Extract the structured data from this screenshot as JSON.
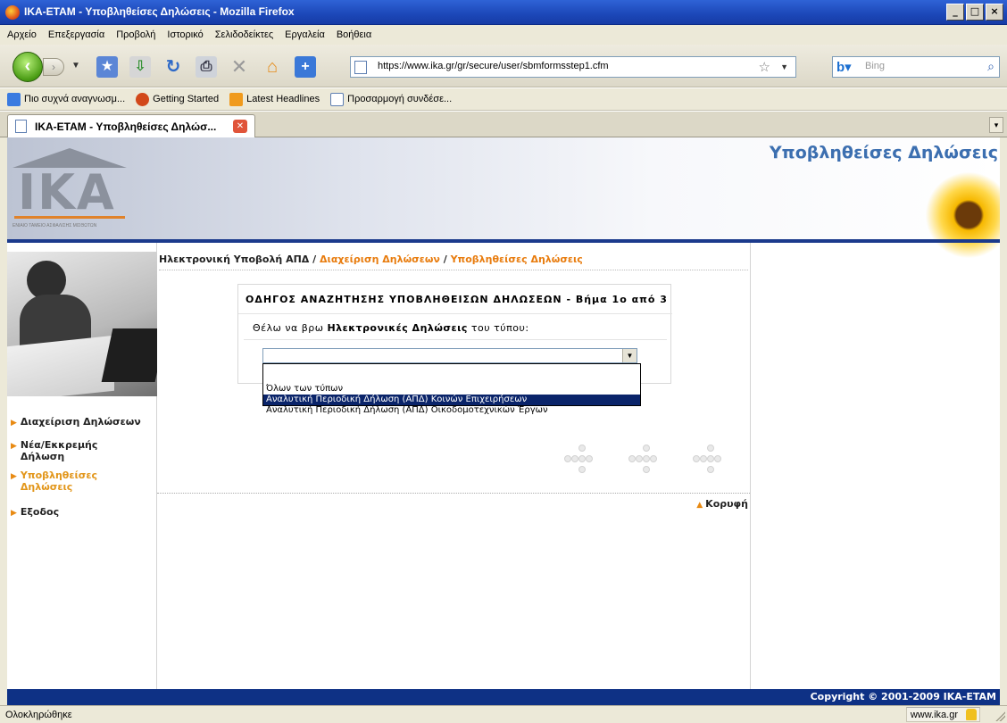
{
  "window": {
    "title": "IKA-ETAM - Υποβληθείσες Δηλώσεις - Mozilla Firefox"
  },
  "menu": [
    "Αρχείο",
    "Επεξεργασία",
    "Προβολή",
    "Ιστορικό",
    "Σελιδοδείκτες",
    "Εργαλεία",
    "Βοήθεια"
  ],
  "toolbar": {
    "url": "https://www.ika.gr/gr/secure/user/sbmformsstep1.cfm",
    "search_placeholder": "Bing"
  },
  "bookmarks": [
    {
      "label": "Πιο συχνά αναγνωσμ...",
      "icon": "star-icon",
      "color": "#3a7be0"
    },
    {
      "label": "Getting Started",
      "icon": "firefox-icon",
      "color": "#d2481a"
    },
    {
      "label": "Latest Headlines",
      "icon": "rss-icon",
      "color": "#f09a1c"
    },
    {
      "label": "Προσαρμογή συνδέσε...",
      "icon": "page-icon",
      "color": "#ffffff"
    }
  ],
  "tab": {
    "title": "IKA-ETAM - Υποβληθείσες Δηλώσ..."
  },
  "header": {
    "logo_text": "IKA",
    "logo_tagline": "ΕΝΙΑΙΟ ΤΑΜΕΙΟ ΑΣΦΑΛΙΣΗΣ ΜΙΣΘΩΤΩΝ",
    "title": "Υποβληθείσες Δηλώσεις"
  },
  "sidebar": {
    "items": [
      {
        "label": "Διαχείριση Δηλώσεων",
        "active": false
      },
      {
        "label": "Νέα/Εκκρεμής Δήλωση",
        "active": false
      },
      {
        "label": "Υποβληθείσες Δηλώσεις",
        "active": true
      },
      {
        "label": "Εξοδος",
        "active": false
      }
    ]
  },
  "breadcrumb": {
    "home": "Ηλεκτρονική Υποβολή ΑΠΔ",
    "sep": " / ",
    "level2": "Διαχείριση Δηλώσεων",
    "level3": "Υποβληθείσες Δηλώσεις"
  },
  "wizard": {
    "title": "ΟΔΗΓΟΣ ΑΝΑΖΗΤΗΣΗΣ ΥΠΟΒΛΗΘΕΙΣΩΝ ΔΗΛΩΣΕΩΝ - Βήμα 1ο από 3",
    "question_prefix": "Θέλω να βρω ",
    "question_bold": "Ηλεκτρονικές Δηλώσεις",
    "question_suffix": " του τύπου:",
    "selected_value": "",
    "options": [
      "Όλων των τύπων",
      "Αναλυτική Περιοδική Δήλωση (ΑΠΔ) Κοινών Επιχειρήσεων",
      "Αναλυτική Περιοδική Δήλωση (ΑΠΔ) Οικοδομοτεχνικών Έργων"
    ],
    "highlighted_option": 1
  },
  "top_link": "Κορυφή",
  "footer": {
    "copyright": "Copyright © 2001-2009 IKA-ETAM"
  },
  "status": {
    "text": "Ολοκληρώθηκε",
    "domain": "www.ika.gr"
  }
}
